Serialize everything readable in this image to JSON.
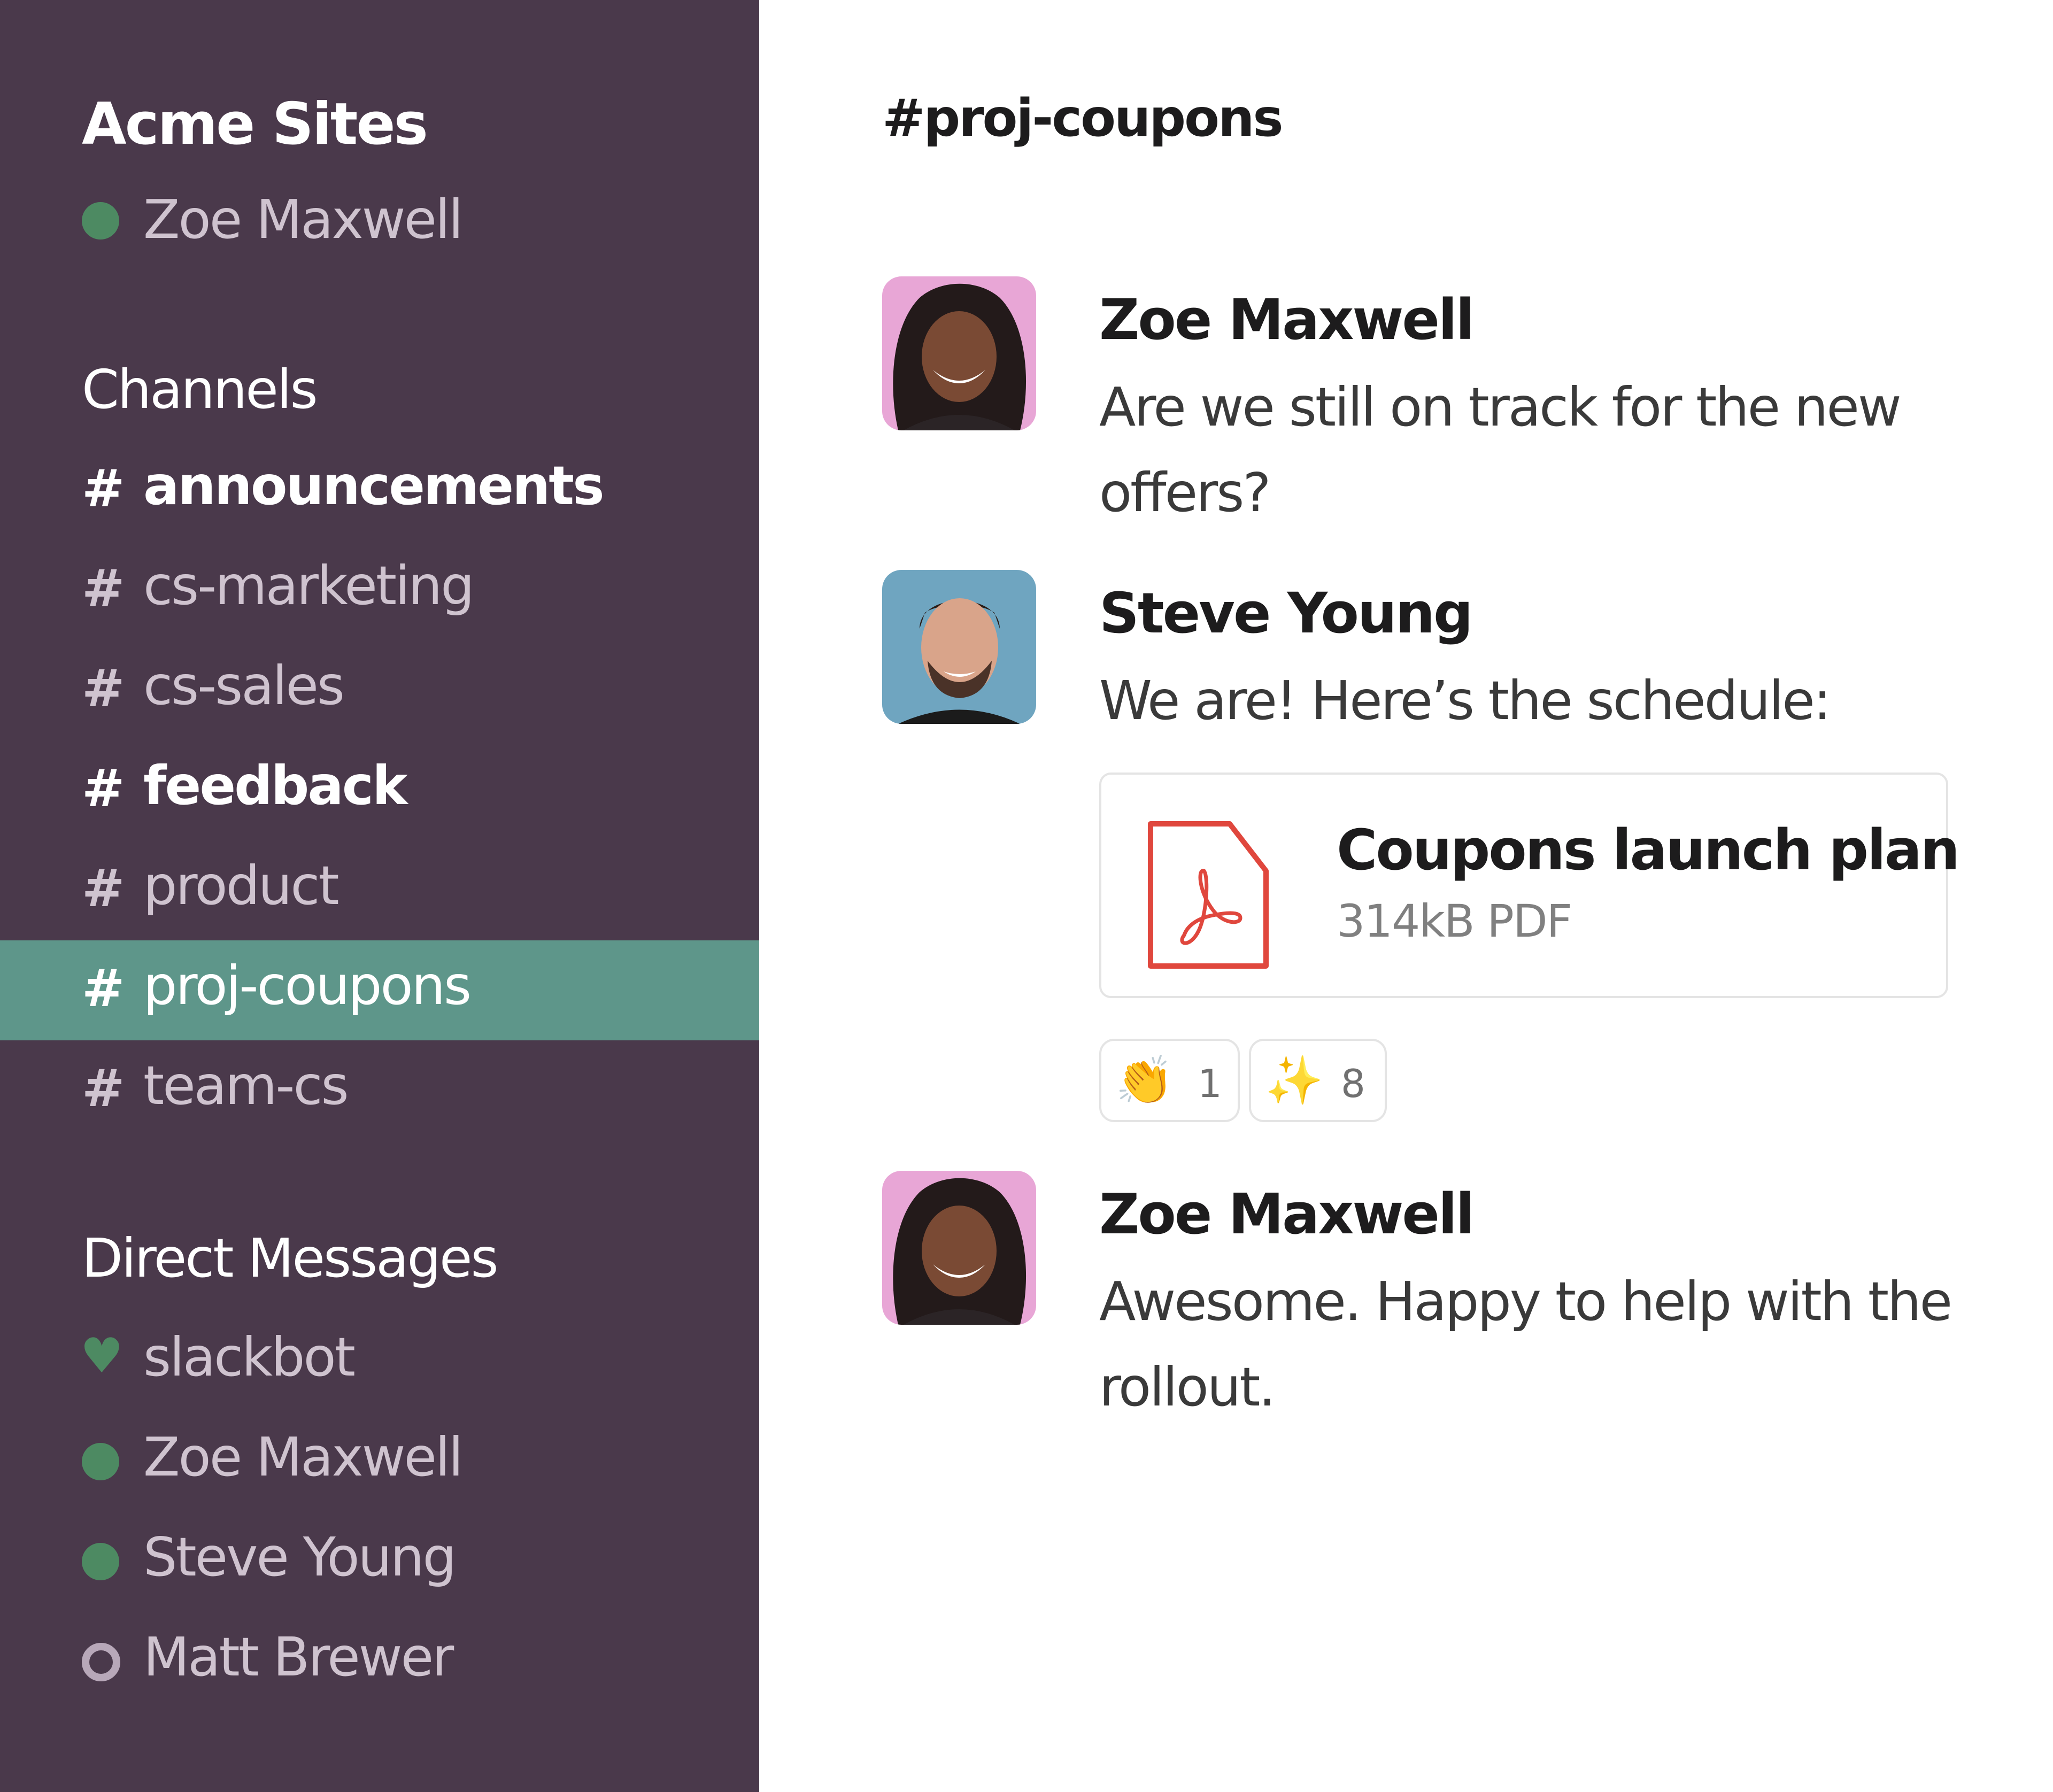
{
  "workspace": {
    "name": "Acme Sites",
    "current_user": "Zoe Maxwell",
    "current_user_status": "active"
  },
  "sidebar": {
    "channels_heading": "Channels",
    "channels": [
      {
        "hash": "#",
        "label": "announcements",
        "unread": true,
        "selected": false
      },
      {
        "hash": "#",
        "label": "cs-marketing",
        "unread": false,
        "selected": false
      },
      {
        "hash": "#",
        "label": "cs-sales",
        "unread": false,
        "selected": false
      },
      {
        "hash": "#",
        "label": "feedback",
        "unread": true,
        "selected": false
      },
      {
        "hash": "#",
        "label": "product",
        "unread": false,
        "selected": false
      },
      {
        "hash": "#",
        "label": "proj-coupons",
        "unread": false,
        "selected": true
      },
      {
        "hash": "#",
        "label": "team-cs",
        "unread": false,
        "selected": false
      }
    ],
    "dm_heading": "Direct Messages",
    "direct_messages": [
      {
        "label": "slackbot",
        "status_icon": "heart-icon",
        "status": "bot"
      },
      {
        "label": "Zoe Maxwell",
        "status_icon": "presence-active-icon",
        "status": "active"
      },
      {
        "label": "Steve Young",
        "status_icon": "presence-active-icon",
        "status": "active"
      },
      {
        "label": "Matt Brewer",
        "status_icon": "presence-away-icon",
        "status": "away"
      }
    ]
  },
  "main": {
    "channel_title": "#proj-coupons",
    "messages": [
      {
        "author": "Zoe Maxwell",
        "avatar": "zoe-avatar",
        "text": "Are we still on track for the new offers?"
      },
      {
        "author": "Steve Young",
        "avatar": "steve-avatar",
        "text": "We are! Here’s the schedule:",
        "attachment": {
          "icon": "pdf-icon",
          "name": "Coupons launch plan",
          "meta": "314kB PDF"
        },
        "reactions": [
          {
            "emoji": "👏",
            "name": "clap-emoji",
            "count": "1"
          },
          {
            "emoji": "✨",
            "name": "sparkles-emoji",
            "count": "8"
          }
        ]
      },
      {
        "author": "Zoe Maxwell",
        "avatar": "zoe-avatar",
        "text": "Awesome. Happy to help with the rollout."
      }
    ]
  },
  "colors": {
    "sidebar_bg": "#4a394b",
    "selected_channel_bg": "#5e968a",
    "presence_active": "#4d8a62",
    "pdf_red": "#e0473d"
  }
}
